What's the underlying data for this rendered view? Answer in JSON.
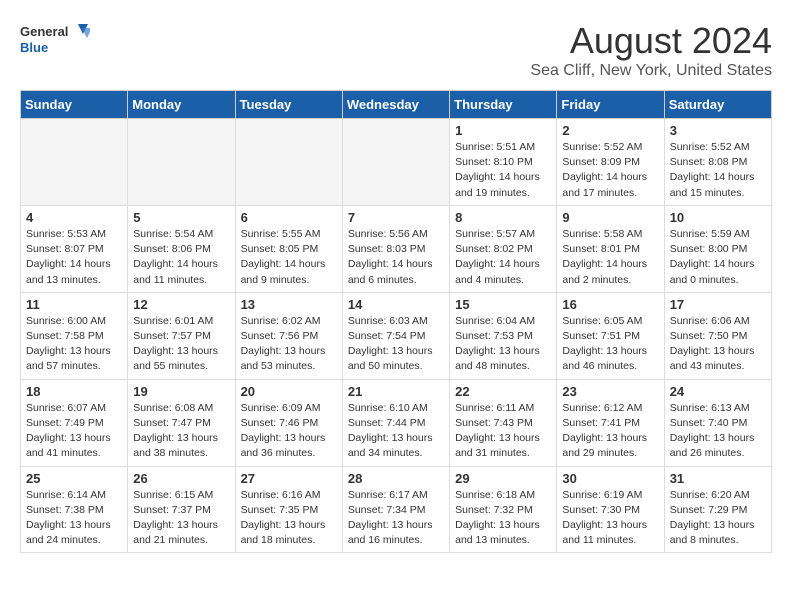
{
  "logo": {
    "line1": "General",
    "line2": "Blue"
  },
  "title": "August 2024",
  "subtitle": "Sea Cliff, New York, United States",
  "days_of_week": [
    "Sunday",
    "Monday",
    "Tuesday",
    "Wednesday",
    "Thursday",
    "Friday",
    "Saturday"
  ],
  "weeks": [
    [
      {
        "day": "",
        "empty": true
      },
      {
        "day": "",
        "empty": true
      },
      {
        "day": "",
        "empty": true
      },
      {
        "day": "",
        "empty": true
      },
      {
        "day": "1",
        "sunrise": "5:51 AM",
        "sunset": "8:10 PM",
        "daylight": "14 hours and 19 minutes."
      },
      {
        "day": "2",
        "sunrise": "5:52 AM",
        "sunset": "8:09 PM",
        "daylight": "14 hours and 17 minutes."
      },
      {
        "day": "3",
        "sunrise": "5:52 AM",
        "sunset": "8:08 PM",
        "daylight": "14 hours and 15 minutes."
      }
    ],
    [
      {
        "day": "4",
        "sunrise": "5:53 AM",
        "sunset": "8:07 PM",
        "daylight": "14 hours and 13 minutes."
      },
      {
        "day": "5",
        "sunrise": "5:54 AM",
        "sunset": "8:06 PM",
        "daylight": "14 hours and 11 minutes."
      },
      {
        "day": "6",
        "sunrise": "5:55 AM",
        "sunset": "8:05 PM",
        "daylight": "14 hours and 9 minutes."
      },
      {
        "day": "7",
        "sunrise": "5:56 AM",
        "sunset": "8:03 PM",
        "daylight": "14 hours and 6 minutes."
      },
      {
        "day": "8",
        "sunrise": "5:57 AM",
        "sunset": "8:02 PM",
        "daylight": "14 hours and 4 minutes."
      },
      {
        "day": "9",
        "sunrise": "5:58 AM",
        "sunset": "8:01 PM",
        "daylight": "14 hours and 2 minutes."
      },
      {
        "day": "10",
        "sunrise": "5:59 AM",
        "sunset": "8:00 PM",
        "daylight": "14 hours and 0 minutes."
      }
    ],
    [
      {
        "day": "11",
        "sunrise": "6:00 AM",
        "sunset": "7:58 PM",
        "daylight": "13 hours and 57 minutes."
      },
      {
        "day": "12",
        "sunrise": "6:01 AM",
        "sunset": "7:57 PM",
        "daylight": "13 hours and 55 minutes."
      },
      {
        "day": "13",
        "sunrise": "6:02 AM",
        "sunset": "7:56 PM",
        "daylight": "13 hours and 53 minutes."
      },
      {
        "day": "14",
        "sunrise": "6:03 AM",
        "sunset": "7:54 PM",
        "daylight": "13 hours and 50 minutes."
      },
      {
        "day": "15",
        "sunrise": "6:04 AM",
        "sunset": "7:53 PM",
        "daylight": "13 hours and 48 minutes."
      },
      {
        "day": "16",
        "sunrise": "6:05 AM",
        "sunset": "7:51 PM",
        "daylight": "13 hours and 46 minutes."
      },
      {
        "day": "17",
        "sunrise": "6:06 AM",
        "sunset": "7:50 PM",
        "daylight": "13 hours and 43 minutes."
      }
    ],
    [
      {
        "day": "18",
        "sunrise": "6:07 AM",
        "sunset": "7:49 PM",
        "daylight": "13 hours and 41 minutes."
      },
      {
        "day": "19",
        "sunrise": "6:08 AM",
        "sunset": "7:47 PM",
        "daylight": "13 hours and 38 minutes."
      },
      {
        "day": "20",
        "sunrise": "6:09 AM",
        "sunset": "7:46 PM",
        "daylight": "13 hours and 36 minutes."
      },
      {
        "day": "21",
        "sunrise": "6:10 AM",
        "sunset": "7:44 PM",
        "daylight": "13 hours and 34 minutes."
      },
      {
        "day": "22",
        "sunrise": "6:11 AM",
        "sunset": "7:43 PM",
        "daylight": "13 hours and 31 minutes."
      },
      {
        "day": "23",
        "sunrise": "6:12 AM",
        "sunset": "7:41 PM",
        "daylight": "13 hours and 29 minutes."
      },
      {
        "day": "24",
        "sunrise": "6:13 AM",
        "sunset": "7:40 PM",
        "daylight": "13 hours and 26 minutes."
      }
    ],
    [
      {
        "day": "25",
        "sunrise": "6:14 AM",
        "sunset": "7:38 PM",
        "daylight": "13 hours and 24 minutes."
      },
      {
        "day": "26",
        "sunrise": "6:15 AM",
        "sunset": "7:37 PM",
        "daylight": "13 hours and 21 minutes."
      },
      {
        "day": "27",
        "sunrise": "6:16 AM",
        "sunset": "7:35 PM",
        "daylight": "13 hours and 18 minutes."
      },
      {
        "day": "28",
        "sunrise": "6:17 AM",
        "sunset": "7:34 PM",
        "daylight": "13 hours and 16 minutes."
      },
      {
        "day": "29",
        "sunrise": "6:18 AM",
        "sunset": "7:32 PM",
        "daylight": "13 hours and 13 minutes."
      },
      {
        "day": "30",
        "sunrise": "6:19 AM",
        "sunset": "7:30 PM",
        "daylight": "13 hours and 11 minutes."
      },
      {
        "day": "31",
        "sunrise": "6:20 AM",
        "sunset": "7:29 PM",
        "daylight": "13 hours and 8 minutes."
      }
    ]
  ]
}
